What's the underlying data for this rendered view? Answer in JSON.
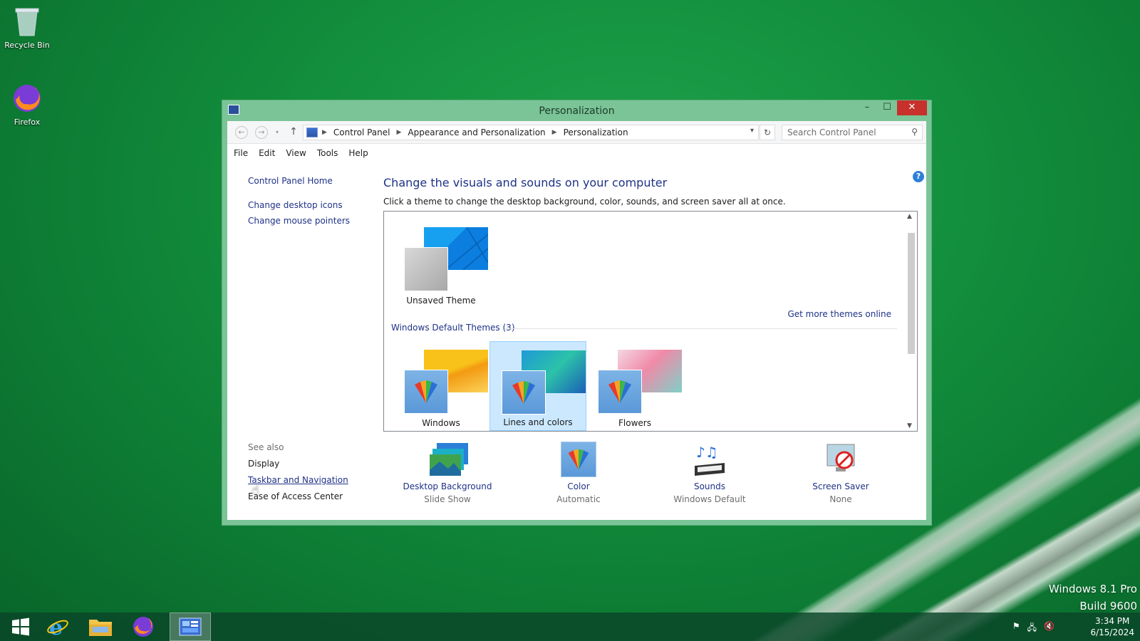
{
  "desktop": {
    "icons": [
      {
        "label": "Recycle Bin",
        "icon": "recycle-bin-icon"
      },
      {
        "label": "Firefox",
        "icon": "firefox-icon"
      }
    ],
    "watermark": {
      "line1": "Windows 8.1 Pro",
      "line2": "Build 9600"
    }
  },
  "window": {
    "title": "Personalization",
    "controls": {
      "minimize": "–",
      "maximize": "☐",
      "close": "✕"
    }
  },
  "address": {
    "crumbs": [
      "Control Panel",
      "Appearance and Personalization",
      "Personalization"
    ],
    "search_placeholder": "Search Control Panel"
  },
  "menu": [
    "File",
    "Edit",
    "View",
    "Tools",
    "Help"
  ],
  "sidebar": {
    "home": "Control Panel Home",
    "links": [
      "Change desktop icons",
      "Change mouse pointers"
    ],
    "see_also_label": "See also",
    "see_also": [
      "Display",
      "Taskbar and Navigation",
      "Ease of Access Center"
    ]
  },
  "main": {
    "heading": "Change the visuals and sounds on your computer",
    "subtext": "Click a theme to change the desktop background, color, sounds, and screen saver all at once.",
    "unsaved_theme": "Unsaved Theme",
    "get_more": "Get more themes online",
    "group_header": "Windows Default Themes (3)",
    "themes": [
      "Windows",
      "Lines and colors",
      "Flowers"
    ],
    "selected_theme": "Lines and colors"
  },
  "settings": [
    {
      "name": "Desktop Background",
      "value": "Slide Show",
      "icon": "desktop-background-icon"
    },
    {
      "name": "Color",
      "value": "Automatic",
      "icon": "color-icon"
    },
    {
      "name": "Sounds",
      "value": "Windows Default",
      "icon": "sounds-icon"
    },
    {
      "name": "Screen Saver",
      "value": "None",
      "icon": "screen-saver-icon"
    }
  ],
  "taskbar": {
    "time": "3:34 PM",
    "date": "6/15/2024",
    "active_app": "control-panel"
  },
  "colors": {
    "link": "#1e3287",
    "titlebar": "#7ac497",
    "close": "#c7302b",
    "selection": "#cce8ff"
  }
}
